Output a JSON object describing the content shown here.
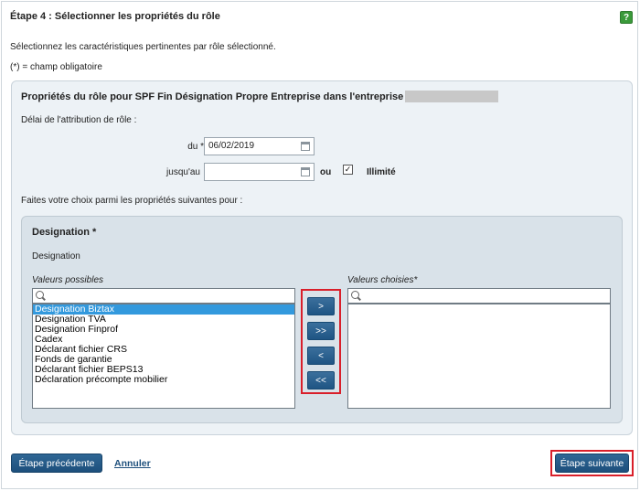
{
  "header": {
    "title": "Étape 4 : Sélectionner les propriétés du rôle",
    "help_icon": "?"
  },
  "instructions": "Sélectionnez les caractéristiques pertinentes par rôle sélectionné.",
  "required_note": "(*) = champ obligatoire",
  "role_panel": {
    "heading": "Propriétés du rôle pour SPF Fin Désignation Propre Entreprise dans l'entreprise",
    "delay_label": "Délai de l'attribution de rôle :",
    "from_label": "du *",
    "from_value": "06/02/2019",
    "until_label": "jusqu'au",
    "until_value": "",
    "or_label": "ou",
    "unlimited_checked": "✓",
    "unlimited_label": "Illimité",
    "choose_label": "Faites votre choix parmi les propriétés suivantes pour :"
  },
  "designation": {
    "title": "Designation *",
    "subtitle": "Designation",
    "possible_label": "Valeurs possibles",
    "chosen_label": "Valeurs choisies*",
    "possible_values": [
      "Designation Biztax",
      "Designation TVA",
      "Designation Finprof",
      "Cadex",
      "Déclarant fichier CRS",
      "Fonds de garantie",
      "Déclarant fichier BEPS13",
      "Déclaration précompte mobilier"
    ],
    "move_buttons": [
      ">",
      ">>",
      "<",
      "<<"
    ]
  },
  "footer": {
    "prev_label": "Étape précédente",
    "cancel_label": "Annuler",
    "next_label": "Étape suivante"
  }
}
